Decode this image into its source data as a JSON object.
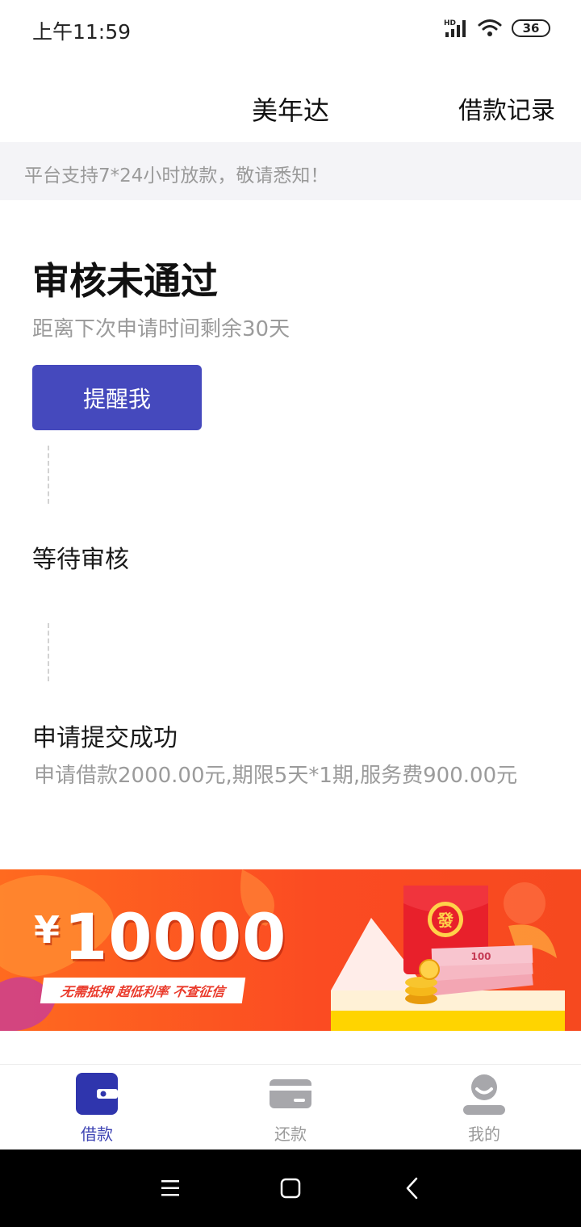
{
  "status_bar": {
    "time": "上午11:59",
    "network": "HD",
    "battery": "36"
  },
  "header": {
    "title": "美年达",
    "record_link": "借款记录"
  },
  "notice": "平台支持7*24小时放款，敬请悉知！",
  "review": {
    "title": "审核未通过",
    "countdown": "距离下次申请时间剩余30天",
    "remind_button": "提醒我"
  },
  "timeline": [
    {
      "label": "等待审核",
      "desc": ""
    },
    {
      "label": "申请提交成功",
      "desc": "申请借款2000.00元,期限5天*1期,服务费900.00元"
    }
  ],
  "banner": {
    "currency": "¥",
    "amount": "10000",
    "tagline": "无需抵押 超低利率 不查征信",
    "red_packet_char": "發",
    "bill_value": "100"
  },
  "tabbar": {
    "items": [
      {
        "label": "借款",
        "icon": "wallet-icon",
        "active": true
      },
      {
        "label": "还款",
        "icon": "card-icon",
        "active": false
      },
      {
        "label": "我的",
        "icon": "user-icon",
        "active": false
      }
    ]
  },
  "colors": {
    "accent": "#4549bd",
    "tab_active": "#3e44b4",
    "banner": "#fb4b22"
  }
}
